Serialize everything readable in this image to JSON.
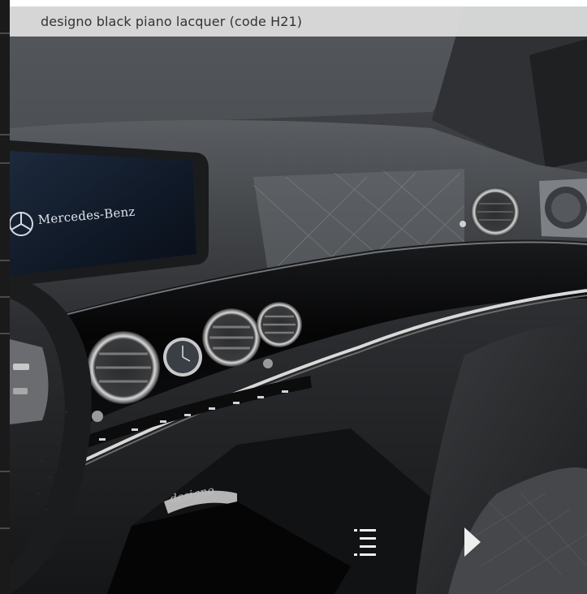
{
  "caption": {
    "text": "designo black piano lacquer (code H21)"
  },
  "photo": {
    "screen_brand": "Mercedes-Benz",
    "console_badge": "designo"
  },
  "navigation": {
    "list_icon": "list-icon",
    "next_icon": "play-right-icon"
  },
  "colors": {
    "caption_bg": "#dedede",
    "caption_text": "#333333",
    "nav_icon": "#eeeeee",
    "left_strip": "#1a1a1a"
  }
}
